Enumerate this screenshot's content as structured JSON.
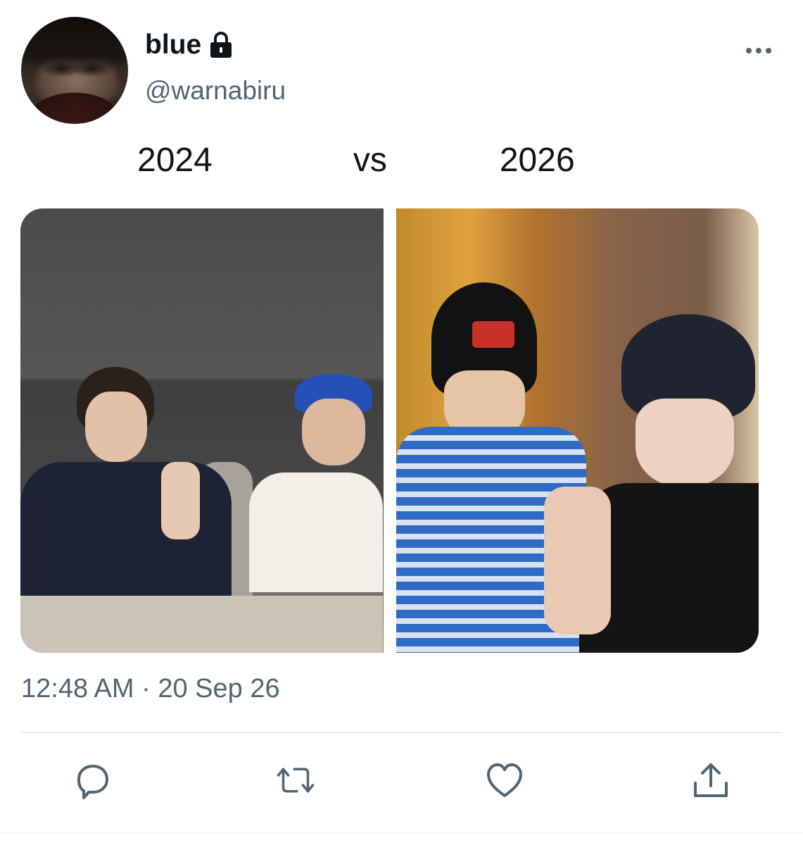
{
  "user": {
    "display_name": "blue",
    "handle": "@warnabiru",
    "protected_icon": "lock-icon",
    "avatar_icon": "profile-photo"
  },
  "tweet": {
    "text": "2024               vs            2026",
    "timestamp": "12:48 AM · 20 Sep 26"
  },
  "media": [
    {
      "name": "photo-2024",
      "description_icon": "photo"
    },
    {
      "name": "photo-2026",
      "description_icon": "photo"
    }
  ],
  "actions": [
    {
      "name": "reply",
      "icon": "speech-bubble-icon"
    },
    {
      "name": "retweet",
      "icon": "retweet-arrows-icon"
    },
    {
      "name": "like",
      "icon": "heart-icon"
    },
    {
      "name": "share",
      "icon": "share-upload-icon"
    }
  ],
  "colors": {
    "secondary_text": "#536471",
    "primary_text": "#0f1419",
    "divider": "#cfd9de"
  }
}
